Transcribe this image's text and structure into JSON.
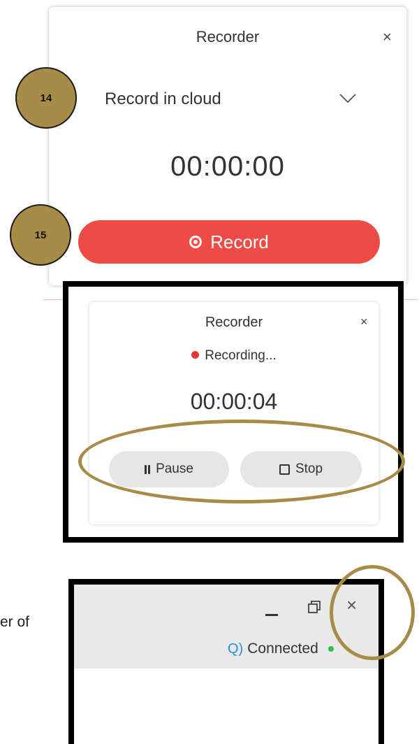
{
  "recorder_panel": {
    "title": "Recorder",
    "close_glyph": "×",
    "dropdown_value": "Record in cloud",
    "timer": "00:00:00",
    "record_button_label": "Record"
  },
  "step_badges": [
    "14",
    "15"
  ],
  "recording_panel": {
    "title": "Recorder",
    "close_glyph": "×",
    "status": "Recording...",
    "timer": "00:00:04",
    "pause_label": "Pause",
    "stop_label": "Stop"
  },
  "window": {
    "close_glyph": "×",
    "status_text": "Connected"
  },
  "cut_text": "er of",
  "colors": {
    "record_red": "#f04a47",
    "badge_gold": "#a88b47",
    "connected_green": "#2fbf4a",
    "mic_blue": "#2a8fd6"
  },
  "icons": [
    "chevron-down-icon",
    "record-icon",
    "pause-icon",
    "stop-icon",
    "close-icon",
    "minimize-icon",
    "restore-icon",
    "microphone-icon"
  ]
}
